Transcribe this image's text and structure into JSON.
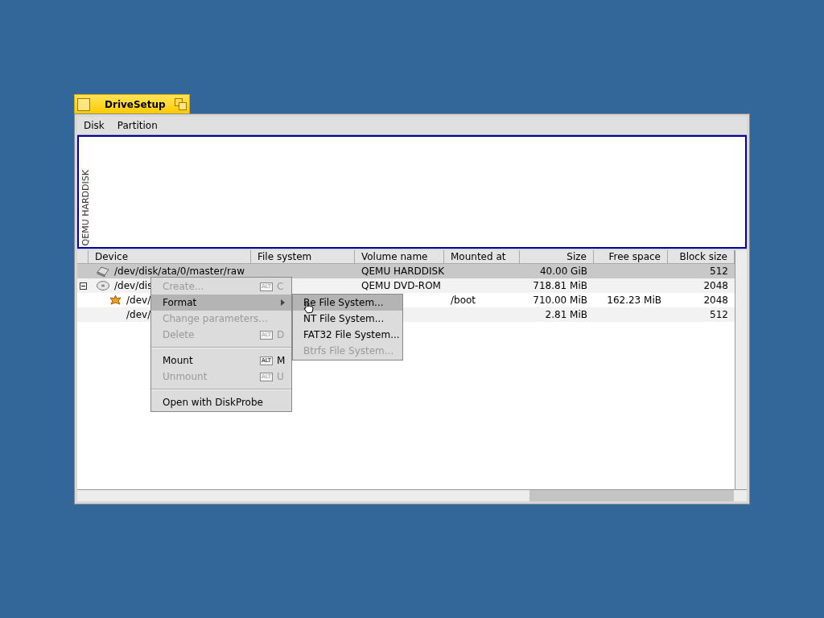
{
  "window": {
    "title": "DriveSetup"
  },
  "menu_bar": [
    "Disk",
    "Partition"
  ],
  "disk_map": {
    "label": "QEMU HARDDISK"
  },
  "table": {
    "columns": [
      "Device",
      "File system",
      "Volume name",
      "Mounted at",
      "Size",
      "Free space",
      "Block size"
    ],
    "rows": [
      {
        "kind": "harddisk",
        "device": "/dev/disk/ata/0/master/raw",
        "volume_name": "QEMU HARDDISK",
        "size": "40.00 GiB",
        "block_size": "512",
        "selected": true
      },
      {
        "kind": "cdrom",
        "device": "/dev/dis",
        "volume_name": "QEMU DVD-ROM",
        "size": "718.81 MiB",
        "block_size": "2048",
        "selected": false,
        "expanded": true,
        "children": [
          {
            "kind": "volume",
            "device": "/dev/",
            "mounted_at": "/boot",
            "size": "710.00 MiB",
            "free_space": "162.23 MiB",
            "block_size": "2048",
            "selected": false
          },
          {
            "kind": "none",
            "device": "/dev/",
            "size": "2.81 MiB",
            "block_size": "512",
            "selected": false
          }
        ]
      }
    ]
  },
  "context_menu": {
    "items": [
      {
        "kind": "item",
        "label": "Create...",
        "disabled": true,
        "selected": false,
        "modifier": "ALT",
        "key": "C"
      },
      {
        "kind": "submenu",
        "label": "Format",
        "disabled": false,
        "selected": true
      },
      {
        "kind": "item",
        "label": "Change parameters...",
        "disabled": true,
        "selected": false
      },
      {
        "kind": "item",
        "label": "Delete",
        "disabled": true,
        "selected": false,
        "modifier": "ALT",
        "key": "D"
      },
      {
        "kind": "separator"
      },
      {
        "kind": "item",
        "label": "Mount",
        "disabled": false,
        "selected": false,
        "modifier": "ALT",
        "key": "M"
      },
      {
        "kind": "item",
        "label": "Unmount",
        "disabled": true,
        "selected": false,
        "modifier": "ALT",
        "key": "U"
      },
      {
        "kind": "separator"
      },
      {
        "kind": "item",
        "label": "Open with DiskProbe",
        "disabled": false,
        "selected": false
      }
    ]
  },
  "submenu": {
    "items": [
      {
        "label": "Be File System...",
        "disabled": false,
        "selected": true
      },
      {
        "label": "NT File System...",
        "disabled": false,
        "selected": false
      },
      {
        "label": "FAT32 File System...",
        "disabled": false,
        "selected": false
      },
      {
        "label": "Btrfs File System...",
        "disabled": true,
        "selected": false
      }
    ]
  }
}
